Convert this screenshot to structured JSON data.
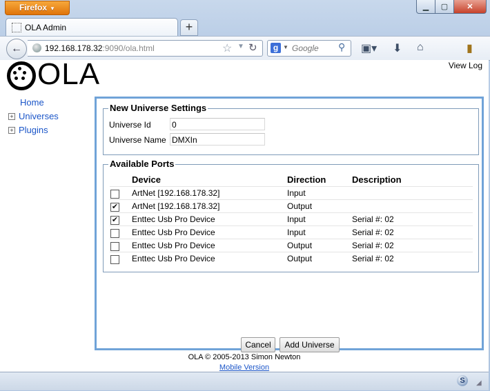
{
  "browser": {
    "app_menu": "Firefox",
    "window_controls": {
      "minimize": "▁",
      "maximize": "▢",
      "close": "✕"
    },
    "tab": {
      "title": "OLA Admin"
    },
    "new_tab": "+",
    "url_host": "192.168.178.32",
    "url_rest": ":9090/ola.html",
    "search_placeholder": "Google"
  },
  "page": {
    "logo_text": "OLA",
    "view_log": "View Log",
    "nav": {
      "home": "Home",
      "universes": "Universes",
      "plugins": "Plugins"
    },
    "settings": {
      "legend": "New Universe Settings",
      "id_label": "Universe Id",
      "id_value": "0",
      "name_label": "Universe Name",
      "name_value": "DMXIn"
    },
    "ports": {
      "legend": "Available Ports",
      "headers": {
        "device": "Device",
        "direction": "Direction",
        "description": "Description"
      },
      "rows": [
        {
          "checked": false,
          "device": "ArtNet [192.168.178.32]",
          "direction": "Input",
          "description": ""
        },
        {
          "checked": true,
          "device": "ArtNet [192.168.178.32]",
          "direction": "Output",
          "description": ""
        },
        {
          "checked": true,
          "device": "Enttec Usb Pro Device",
          "direction": "Input",
          "description": "Serial #: 02"
        },
        {
          "checked": false,
          "device": "Enttec Usb Pro Device",
          "direction": "Input",
          "description": "Serial #: 02"
        },
        {
          "checked": false,
          "device": "Enttec Usb Pro Device",
          "direction": "Output",
          "description": "Serial #: 02"
        },
        {
          "checked": false,
          "device": "Enttec Usb Pro Device",
          "direction": "Output",
          "description": "Serial #: 02"
        }
      ]
    },
    "buttons": {
      "cancel": "Cancel",
      "add": "Add Universe"
    },
    "footer": {
      "copyright": "OLA © 2005-2013 Simon Newton",
      "mobile": "Mobile Version"
    }
  }
}
